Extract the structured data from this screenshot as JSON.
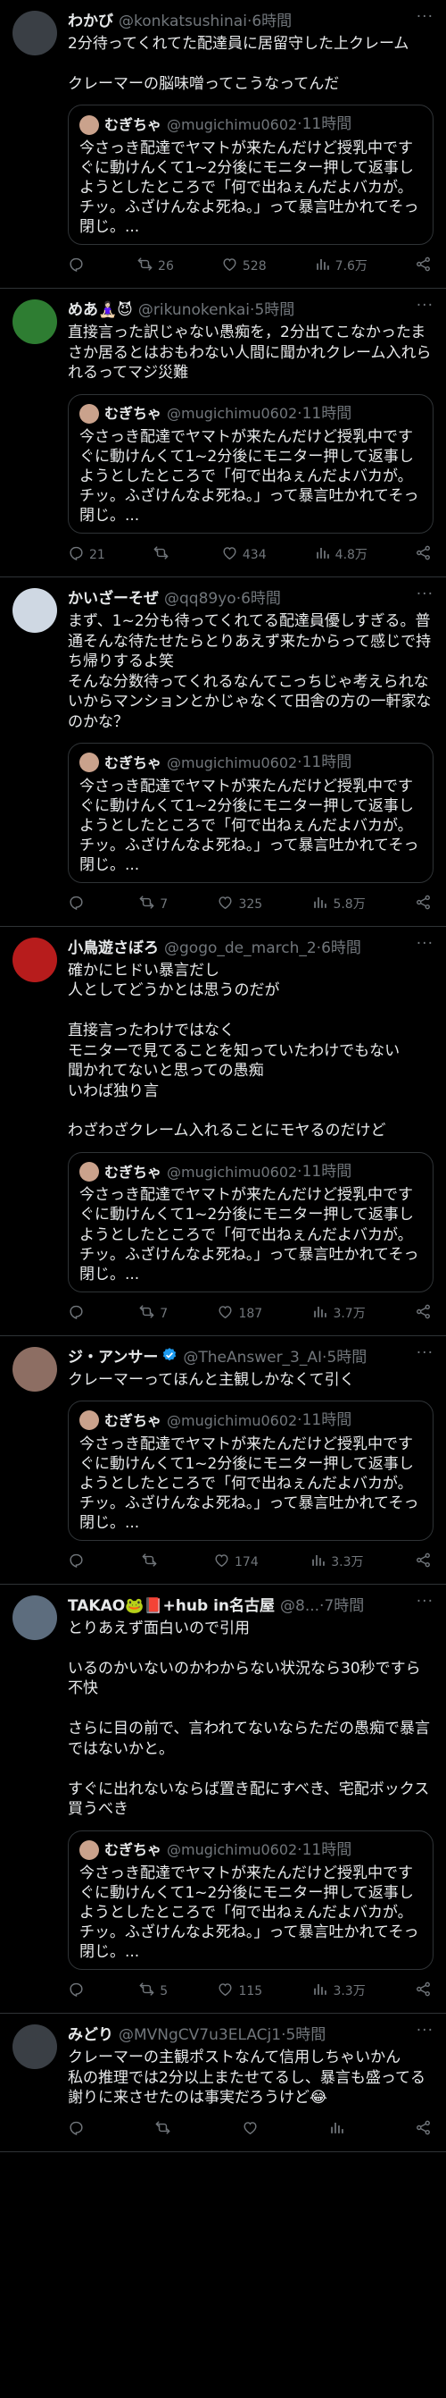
{
  "tweets": [
    {
      "name": "わかび",
      "handle": "@konkatsushinai",
      "time": "6時間",
      "avatar_color": "#3a3f45",
      "text": "2分待ってくれてた配達員に居留守した上クレーム\n\nクレーマーの脳味噌ってこうなってんだ",
      "quote": true,
      "replies": "",
      "retweets": "26",
      "likes": "528",
      "views": "7.6万"
    },
    {
      "name": "めあ🧘🏻‍♀️😈",
      "handle": "@rikunokenkai",
      "time": "5時間",
      "avatar_color": "#2e7d32",
      "text": "直接言った訳じゃない愚痴を，2分出てこなかったまさか居るとはおもわない人間に聞かれクレーム入れられるってマジ災難",
      "quote": true,
      "replies": "21",
      "retweets": "",
      "likes": "434",
      "views": "4.8万"
    },
    {
      "name": "かいざーそぜ",
      "handle": "@qq89yo",
      "time": "6時間",
      "avatar_color": "#cfd8e3",
      "text": "まず、1~2分も待ってくれてる配達員優しすぎる。普通そんな待たせたらとりあえず来たからって感じで持ち帰りするよ笑\nそんな分数待ってくれるなんてこっちじゃ考えられないからマンションとかじゃなくて田舎の方の一軒家なのかな？",
      "quote": true,
      "replies": "",
      "retweets": "7",
      "likes": "325",
      "views": "5.8万"
    },
    {
      "name": "小鳥遊さぼろ",
      "handle": "@gogo_de_march_2",
      "time": "6時間",
      "avatar_color": "#b71c1c",
      "text": "確かにヒドい暴言だし\n人としてどうかとは思うのだが\n\n直接言ったわけではなく\nモニターで見てることを知っていたわけでもない\n聞かれてないと思っての愚痴\nいわば独り言\n\nわざわざクレーム入れることにモヤるのだけど",
      "quote": true,
      "replies": "",
      "retweets": "7",
      "likes": "187",
      "views": "3.7万"
    },
    {
      "name": "ジ・アンサー",
      "handle": "@TheAnswer_3_AI",
      "time": "5時間",
      "verified": true,
      "avatar_color": "#8d6e63",
      "text": "クレーマーってほんと主観しかなくて引く",
      "quote": true,
      "replies": "",
      "retweets": "",
      "likes": "174",
      "views": "3.3万"
    },
    {
      "name": "TAKAO🐸📕+hub in名古屋",
      "handle": "@8...",
      "time": "7時間",
      "avatar_color": "#5d6d7e",
      "text": "とりあえず面白いので引用\n\nいるのかいないのかわからない状況なら30秒ですら不快\n\nさらに目の前で、言われてないならただの愚痴で暴言ではないかと。\n\nすぐに出れないならば置き配にすべき、宅配ボックス買うべき",
      "quote": true,
      "replies": "",
      "retweets": "5",
      "likes": "115",
      "views": "3.3万"
    },
    {
      "name": "みどり",
      "handle": "@MVNgCV7u3ELACj1",
      "time": "5時間",
      "avatar_color": "#3a3f45",
      "text": "クレーマーの主観ポストなんて信用しちゃいかん\n私の推理では2分以上またせてるし、暴言も盛ってる\n謝りに来させたのは事実だろうけど😂",
      "quote": false,
      "replies": "",
      "retweets": "",
      "likes": "",
      "views": ""
    }
  ],
  "quote": {
    "name": "むぎちゃ",
    "handle": "@mugichimu0602",
    "time": "11時間",
    "text": "今さっき配達でヤマトが来たんだけど授乳中ですぐに動けんくて1~2分後にモニター押して返事しようとしたところで「何で出ねぇんだよバカが。チッ。ふざけんなよ死ね。」って暴言吐かれてそっ閉じ。..."
  },
  "ui": {
    "dot": "·",
    "more": "···"
  }
}
